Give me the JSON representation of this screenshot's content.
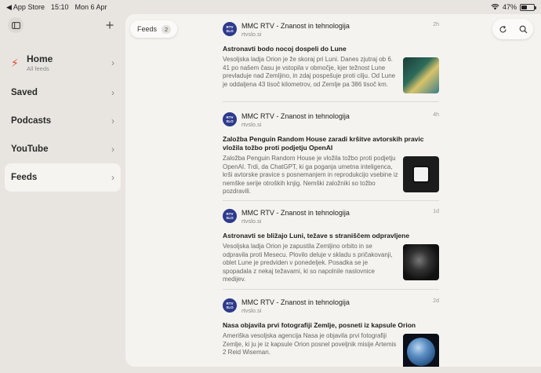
{
  "statusbar": {
    "back_app": "◀ App Store",
    "time": "15:10",
    "date": "Mon 6 Apr",
    "battery": "47%",
    "battery_level": 0.47
  },
  "sidebar": {
    "items": [
      {
        "label": "Home",
        "sub": "All feeds"
      },
      {
        "label": "Saved"
      },
      {
        "label": "Podcasts"
      },
      {
        "label": "YouTube"
      },
      {
        "label": "Feeds"
      }
    ]
  },
  "toolbar": {
    "feeds_label": "Feeds",
    "feeds_count": "2"
  },
  "articles": [
    {
      "source": "MMC RTV - Znanost in tehnologija",
      "domain": "rtvslo.si",
      "age": "2h",
      "title": "Astronavti bodo nocoj dospeli do Lune",
      "body": "Vesoljska ladja Orion je že skoraj pri Luni. Danes zjutraj ob 6. 41 po našem času je vstopila v območje, kjer težnost Lune prevladuje nad Zemljino, in zdaj pospešuje proti cilju. Od Lune je oddaljena 43 tisoč kilometrov, od Zemlje pa 386 tisoč km."
    },
    {
      "source": "MMC RTV - Znanost in tehnologija",
      "domain": "rtvslo.si",
      "age": "4h",
      "title": "Založba Penguin Random House zaradi kršitve avtorskih pravic vložila tožbo proti podjetju OpenAI",
      "body": "Založba Penguin Random House je vložila tožbo proti podjetju OpenAI. Trdi, da ChatGPT, ki ga poganja umetna inteligenca, krši avtorske pravice s posnemanjem in reprodukcijo vsebine iz nemške serije otroških knjig. Nemški založniki so tožbo pozdravili."
    },
    {
      "source": "MMC RTV - Znanost in tehnologija",
      "domain": "rtvslo.si",
      "age": "1d",
      "title": "Astronavti se bližajo Luni, težave s straniščem odpravljene",
      "body": "Vesoljska ladja Orion je zapustila Zemljino orbito in se odpravila proti Mesecu. Plovilo deluje v skladu s pričakovanji, oblet Lune je predviden v ponedeljek. Posadka se je spopadala z nekaj težavami, ki so napolnile naslovnice medijev."
    },
    {
      "source": "MMC RTV - Znanost in tehnologija",
      "domain": "rtvslo.si",
      "age": "2d",
      "title": "Nasa objavila prvi fotografiji Zemlje, posneti iz kapsule Orion",
      "body": "Ameriška vesoljska agencija Nasa je objavila prvi fotografiji Zemlje, ki ju je iz kapsule Orion posnel poveljnik misije Artemis 2 Reid Wiseman."
    }
  ],
  "logo_text": "RTV SLO",
  "icons": {
    "sidebar_toggle": "sidebar-icon",
    "add": "plus-icon",
    "refresh": "refresh-icon",
    "search": "search-icon"
  }
}
